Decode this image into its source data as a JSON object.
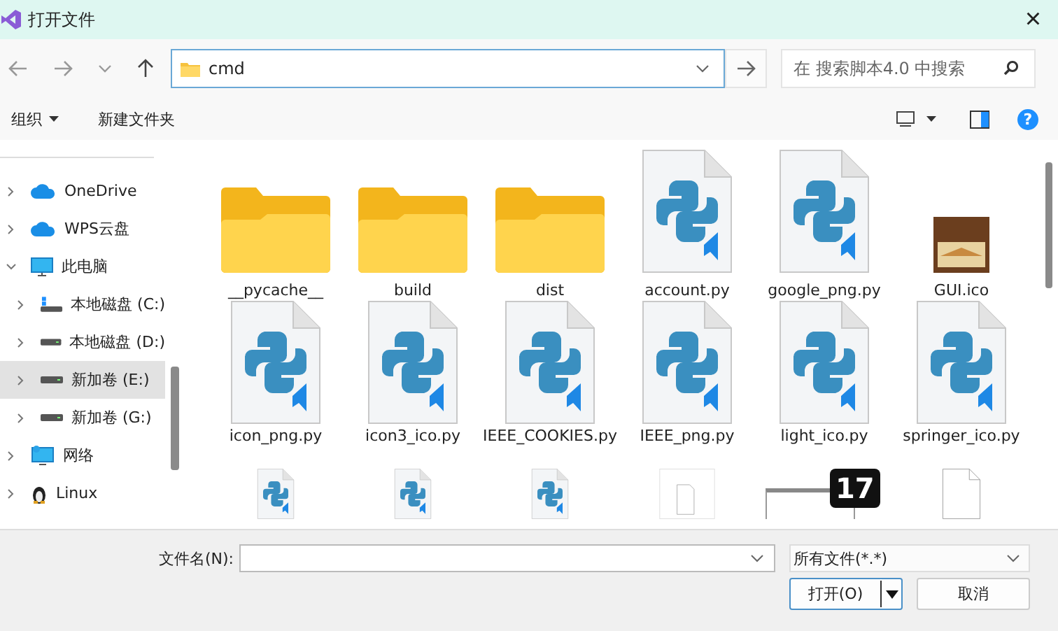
{
  "window": {
    "title": "打开文件",
    "close": "×"
  },
  "nav": {
    "address": "cmd",
    "search": {
      "placeholder": "在 搜索脚本4.0 中搜索"
    }
  },
  "toolbar": {
    "organize": "组织",
    "new_folder": "新建文件夹",
    "help": "?"
  },
  "sidebar": {
    "items": [
      {
        "label": "OneDrive",
        "kind": "cloud",
        "expanded": false,
        "selected": false
      },
      {
        "label": "WPS云盘",
        "kind": "cloud",
        "expanded": false,
        "selected": false
      },
      {
        "label": "此电脑",
        "kind": "pc",
        "expanded": true,
        "selected": false,
        "children": [
          {
            "label": "本地磁盘 (C:)",
            "kind": "system-drive",
            "expanded": false,
            "selected": false
          },
          {
            "label": "本地磁盘 (D:)",
            "kind": "drive",
            "expanded": false,
            "selected": false
          },
          {
            "label": "新加卷 (E:)",
            "kind": "drive",
            "expanded": false,
            "selected": true
          },
          {
            "label": "新加卷 (G:)",
            "kind": "drive",
            "expanded": false,
            "selected": false
          }
        ]
      },
      {
        "label": "网络",
        "kind": "network",
        "expanded": false,
        "selected": false
      },
      {
        "label": "Linux",
        "kind": "penguin",
        "expanded": false,
        "selected": false
      }
    ]
  },
  "files": [
    {
      "name": "__pycache__",
      "kind": "folder"
    },
    {
      "name": "build",
      "kind": "folder"
    },
    {
      "name": "dist",
      "kind": "folder"
    },
    {
      "name": "account.py",
      "kind": "python"
    },
    {
      "name": "google_png.py",
      "kind": "python"
    },
    {
      "name": "GUI.ico",
      "kind": "image"
    },
    {
      "name": "icon_png.py",
      "kind": "python"
    },
    {
      "name": "icon3_ico.py",
      "kind": "python"
    },
    {
      "name": "IEEE_COOKIES.py",
      "kind": "python"
    },
    {
      "name": "IEEE_png.py",
      "kind": "python"
    },
    {
      "name": "light_ico.py",
      "kind": "python"
    },
    {
      "name": "springer_ico.py",
      "kind": "python"
    },
    {
      "kind": "python"
    },
    {
      "kind": "python"
    },
    {
      "kind": "python"
    },
    {
      "kind": "blank-frame"
    },
    {
      "kind": "calendar",
      "badge": "17"
    },
    {
      "kind": "blank"
    }
  ],
  "footer": {
    "filename_label": "文件名(N):",
    "filter": "所有文件(*.*)",
    "open": "打开(O)",
    "cancel": "取消"
  }
}
